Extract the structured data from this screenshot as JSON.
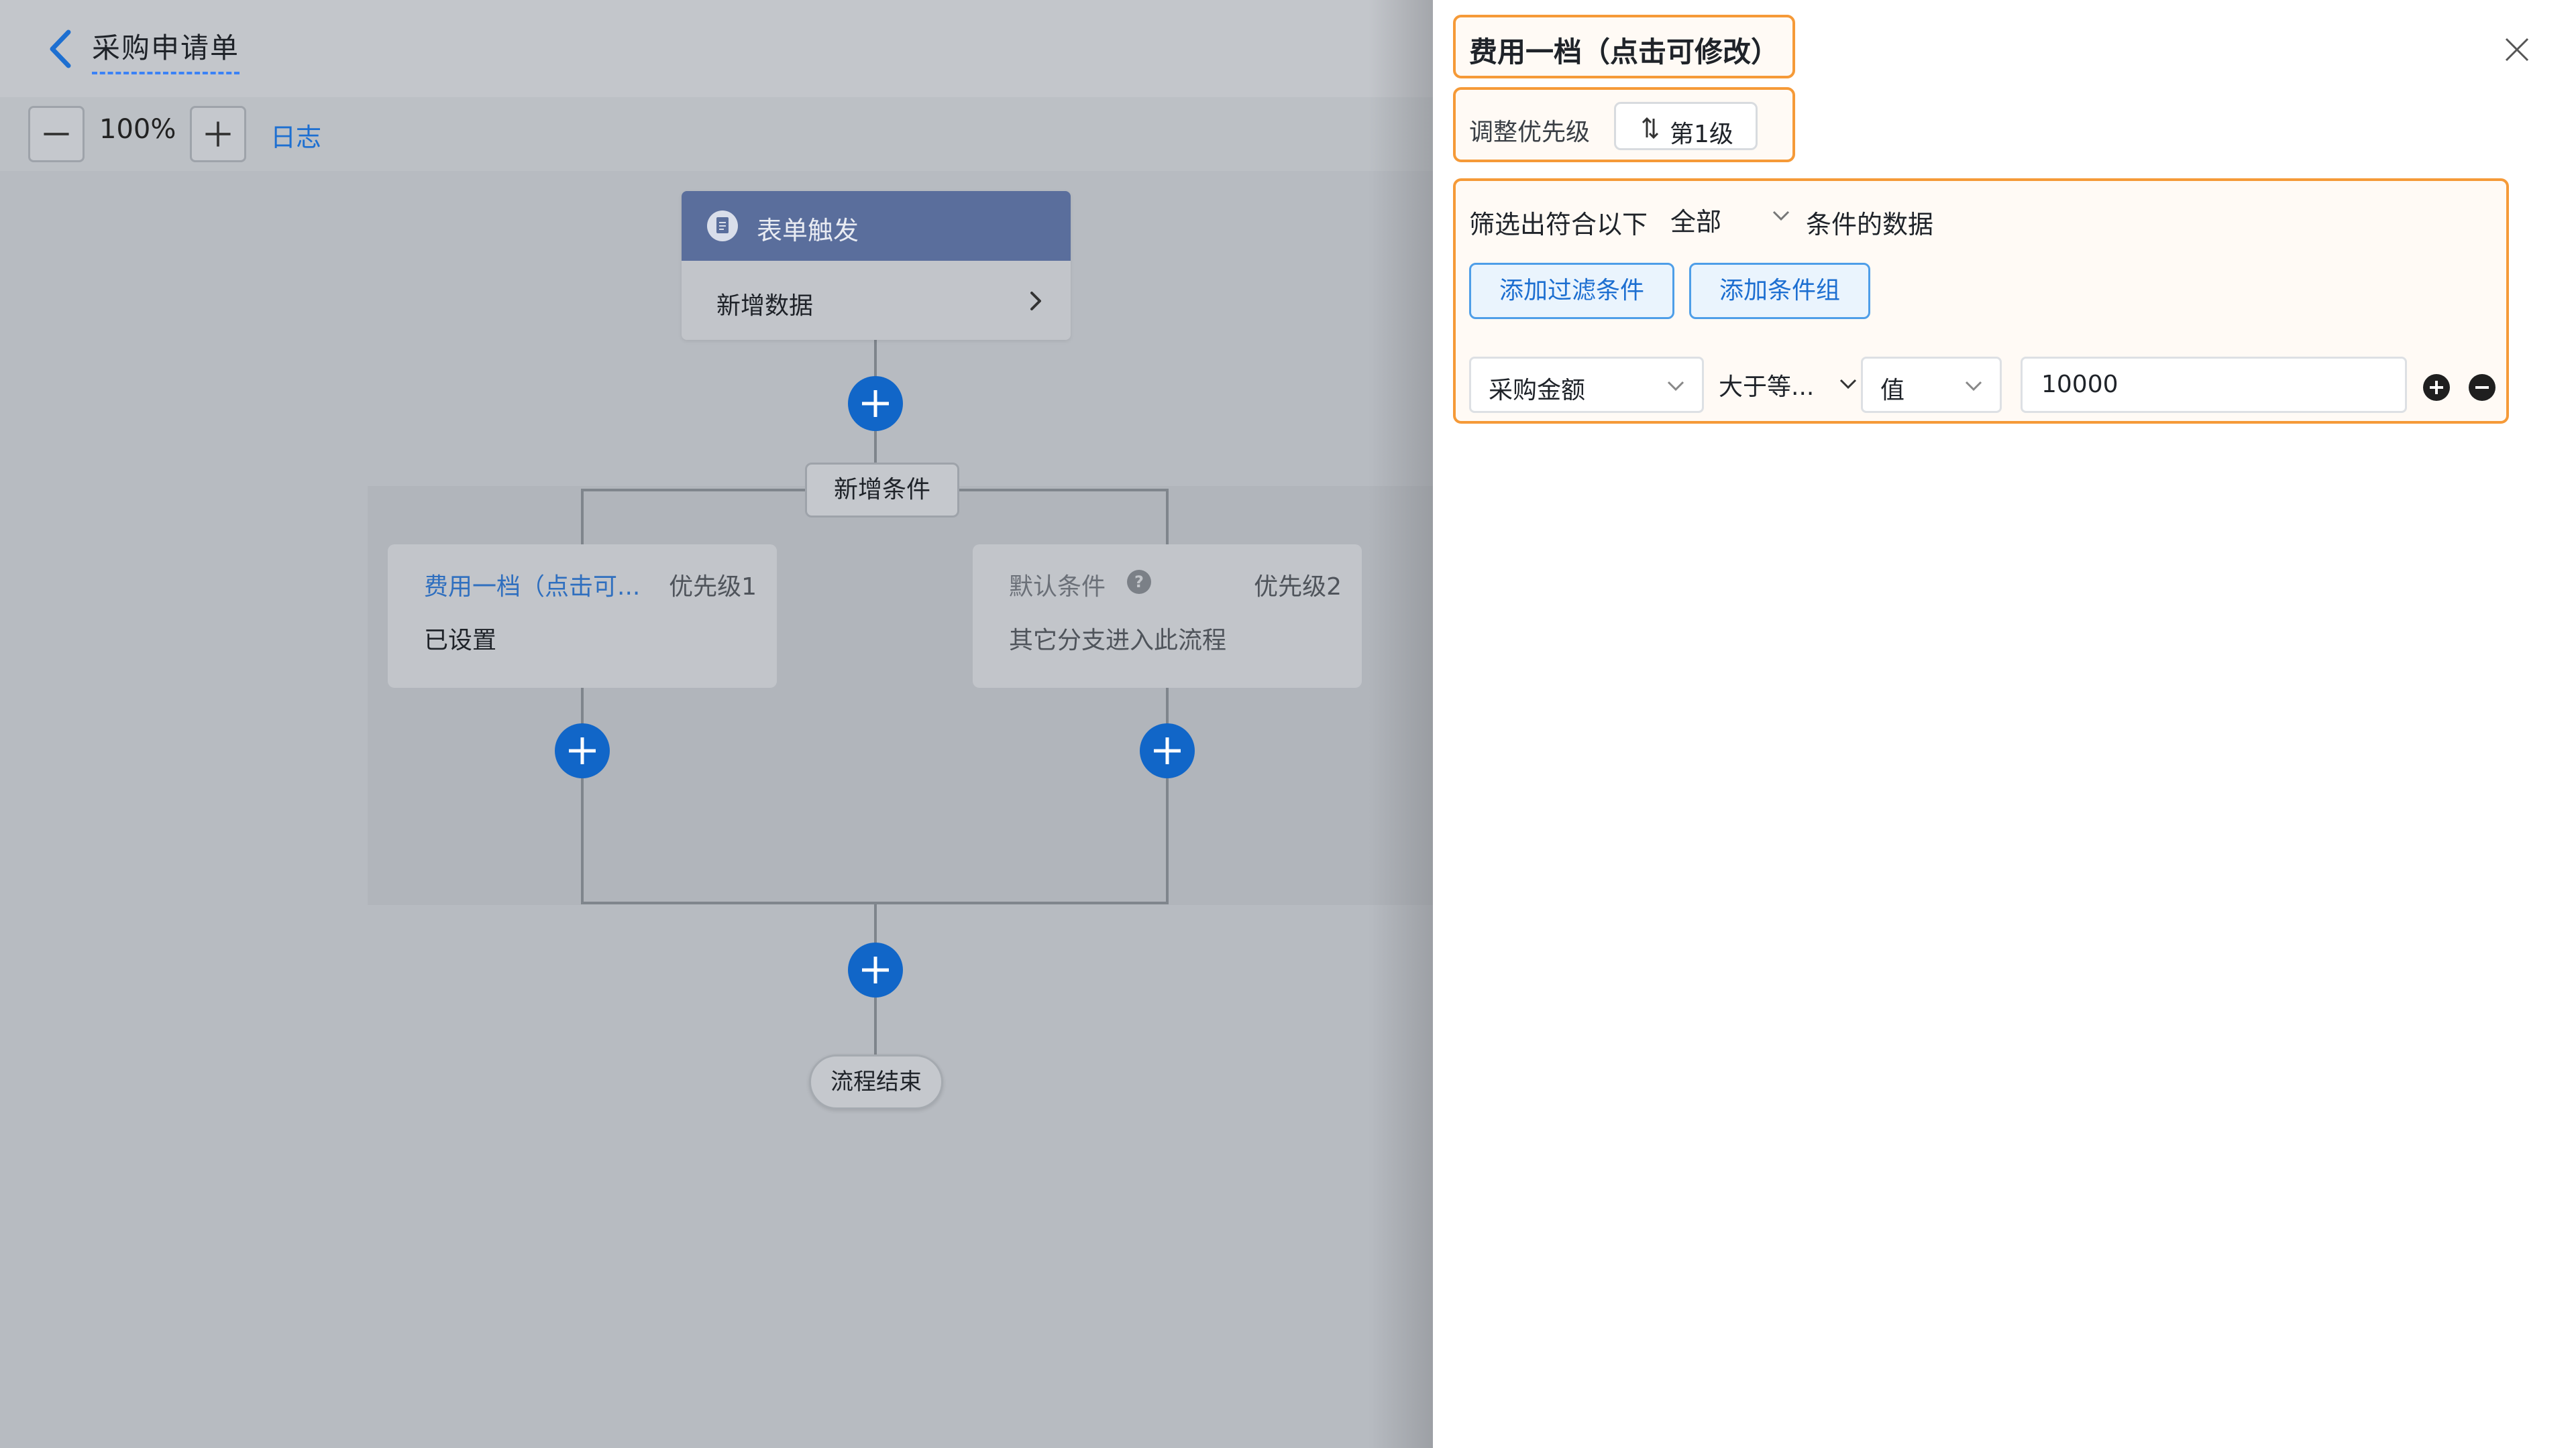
{
  "header": {
    "title": "采购申请单"
  },
  "toolbar": {
    "zoom_level": "100%",
    "log_label": "日志"
  },
  "flow": {
    "trigger": {
      "title": "表单触发",
      "action": "新增数据"
    },
    "add_condition_label": "新增条件",
    "branches": [
      {
        "name": "费用一档（点击可...",
        "priority": "优先级1",
        "description": "已设置"
      },
      {
        "name": "默认条件",
        "priority": "优先级2",
        "description": "其它分支进入此流程"
      }
    ],
    "end_label": "流程结束"
  },
  "panel": {
    "title": "费用一档（点击可修改）",
    "priority_label": "调整优先级",
    "priority_value": "第1级",
    "filter_prefix": "筛选出符合以下",
    "filter_scope": "全部",
    "filter_suffix": "条件的数据",
    "add_filter_label": "添加过滤条件",
    "add_group_label": "添加条件组",
    "condition": {
      "field": "采购金额",
      "operator": "大于等...",
      "value_type": "值",
      "value": "10000"
    }
  },
  "colors": {
    "accent_blue": "#1d6fd1",
    "highlight_orange": "#f59a38",
    "trigger_header": "#5a6e9c"
  }
}
